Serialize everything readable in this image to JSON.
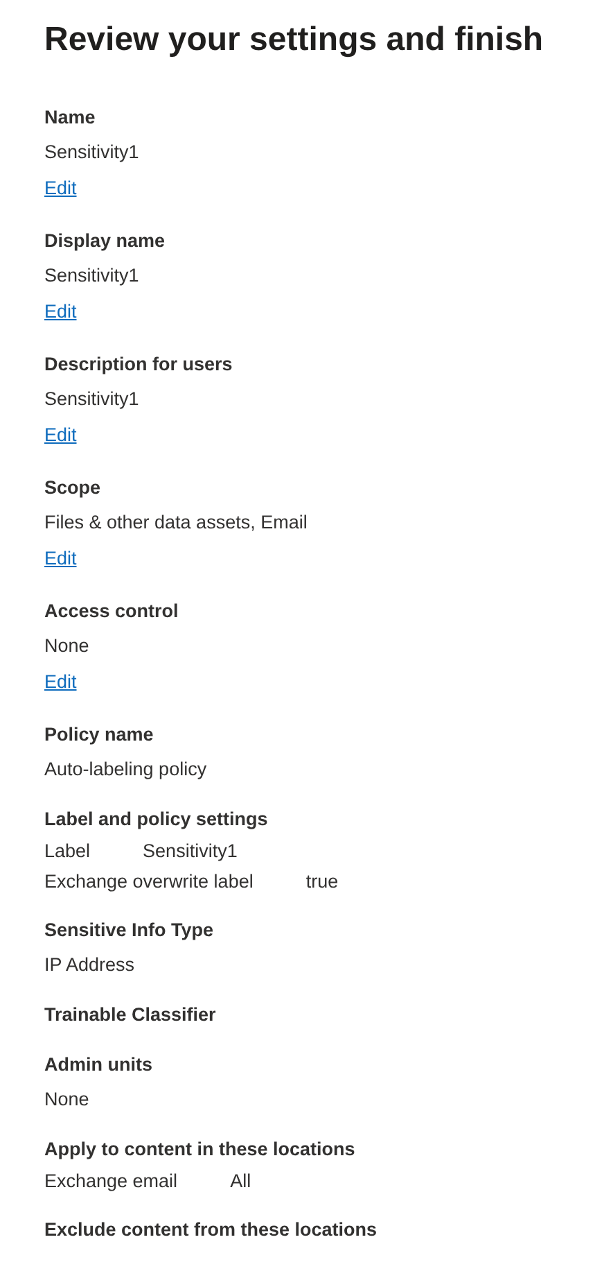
{
  "title": "Review your settings and finish",
  "sections": [
    {
      "heading": "Name",
      "lines": [
        {
          "kind": "text",
          "text": "Sensitivity1"
        }
      ],
      "edit_link": "Edit"
    },
    {
      "heading": "Display name",
      "lines": [
        {
          "kind": "text",
          "text": "Sensitivity1"
        }
      ],
      "edit_link": "Edit"
    },
    {
      "heading": "Description for users",
      "lines": [
        {
          "kind": "text",
          "text": "Sensitivity1"
        }
      ],
      "edit_link": "Edit"
    },
    {
      "heading": "Scope",
      "lines": [
        {
          "kind": "text",
          "text": "Files & other data assets, Email"
        }
      ],
      "edit_link": "Edit"
    },
    {
      "heading": "Access control",
      "lines": [
        {
          "kind": "text",
          "text": "None"
        }
      ],
      "edit_link": "Edit"
    },
    {
      "heading": "Policy name",
      "lines": [
        {
          "kind": "text",
          "text": "Auto-labeling policy"
        }
      ]
    },
    {
      "heading": "Label and policy settings",
      "lines": [
        {
          "kind": "pair",
          "key": "Label",
          "value": "Sensitivity1"
        },
        {
          "kind": "pair",
          "key": "Exchange overwrite label",
          "value": "true"
        }
      ]
    },
    {
      "heading": "Sensitive Info Type",
      "lines": [
        {
          "kind": "text",
          "text": "IP Address"
        }
      ]
    },
    {
      "heading": "Trainable Classifier"
    },
    {
      "heading": "Admin units",
      "lines": [
        {
          "kind": "text",
          "text": "None"
        }
      ]
    },
    {
      "heading": "Apply to content in these locations",
      "lines": [
        {
          "kind": "pair",
          "key": "Exchange email",
          "value": "All"
        }
      ]
    },
    {
      "heading": "Exclude content from these locations"
    }
  ]
}
